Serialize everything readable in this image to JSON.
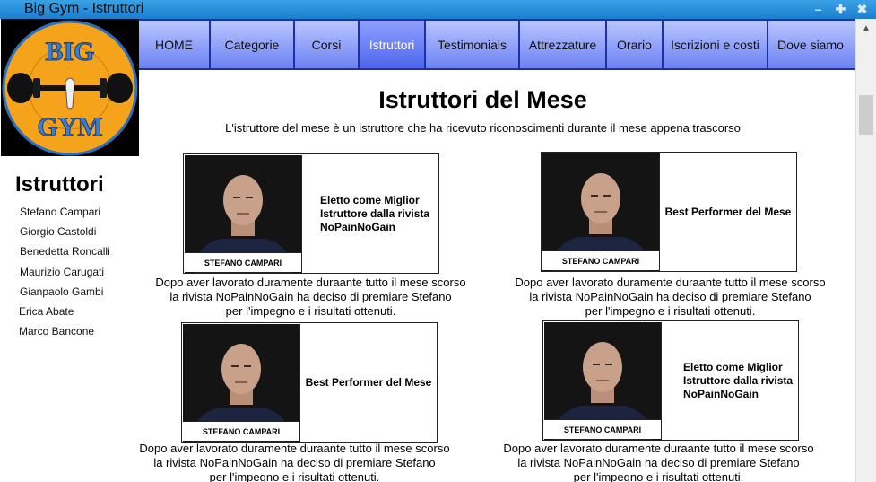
{
  "window": {
    "title": "Big Gym - Istruttori",
    "controls": [
      "minimize-icon",
      "maximize-icon",
      "close-icon"
    ]
  },
  "logo": {
    "text_top": "BIG",
    "text_bottom": "GYM",
    "colors": {
      "ring": "#f5a31a",
      "background": "#000000",
      "text": "#3a7ed0"
    }
  },
  "nav": {
    "items": [
      {
        "label": "HOME",
        "active": false
      },
      {
        "label": "Categorie",
        "active": false
      },
      {
        "label": "Corsi",
        "active": false
      },
      {
        "label": "Istruttori",
        "active": true
      },
      {
        "label": "Testimonials",
        "active": false
      },
      {
        "label": "Attrezzature",
        "active": false
      },
      {
        "label": "Orario",
        "active": false
      },
      {
        "label": "Iscrizioni e costi",
        "active": false
      },
      {
        "label": "Dove siamo",
        "active": false
      }
    ]
  },
  "sidebar": {
    "title": "Istruttori",
    "links": [
      "Stefano Campari",
      "Giorgio Castoldi",
      "Benedetta Roncalli",
      "Maurizio Carugati",
      "Gianpaolo Gambi",
      "Erica Abate",
      "Marco Bancone"
    ]
  },
  "main": {
    "title": "Istruttori del Mese",
    "subtitle": "L'istruttore del mese è un istruttore che ha ricevuto riconoscimenti durante il mese appena trascorso",
    "cards": [
      {
        "caption": "STEFANO CAMPARI",
        "award": "Eletto come Miglior Istruttore dalla rivista NoPainNoGain",
        "desc": [
          "Dopo aver lavorato duramente duraante tutto il mese scorso",
          "la rivista NoPainNoGain ha deciso di premiare Stefano",
          "per l'impegno e i risultati ottenuti."
        ]
      },
      {
        "caption": "STEFANO CAMPARI",
        "award": "Best Performer del Mese",
        "desc": [
          "Dopo aver lavorato duramente duraante tutto il mese scorso",
          "la rivista NoPainNoGain ha deciso di premiare Stefano",
          "per l'impegno e i risultati ottenuti."
        ]
      },
      {
        "caption": "STEFANO CAMPARI",
        "award": "Best Performer del Mese",
        "desc": [
          "Dopo aver lavorato duramente duraante tutto il mese scorso",
          "la rivista NoPainNoGain ha deciso di premiare Stefano",
          "per l'impegno e i risultati ottenuti."
        ]
      },
      {
        "caption": "STEFANO CAMPARI",
        "award": "Eletto come Miglior Istruttore dalla rivista NoPainNoGain",
        "desc": [
          "Dopo aver lavorato duramente duraante tutto il mese scorso",
          "la rivista NoPainNoGain ha deciso di premiare Stefano",
          "per l'impegno e i risultati ottenuti."
        ]
      }
    ]
  }
}
